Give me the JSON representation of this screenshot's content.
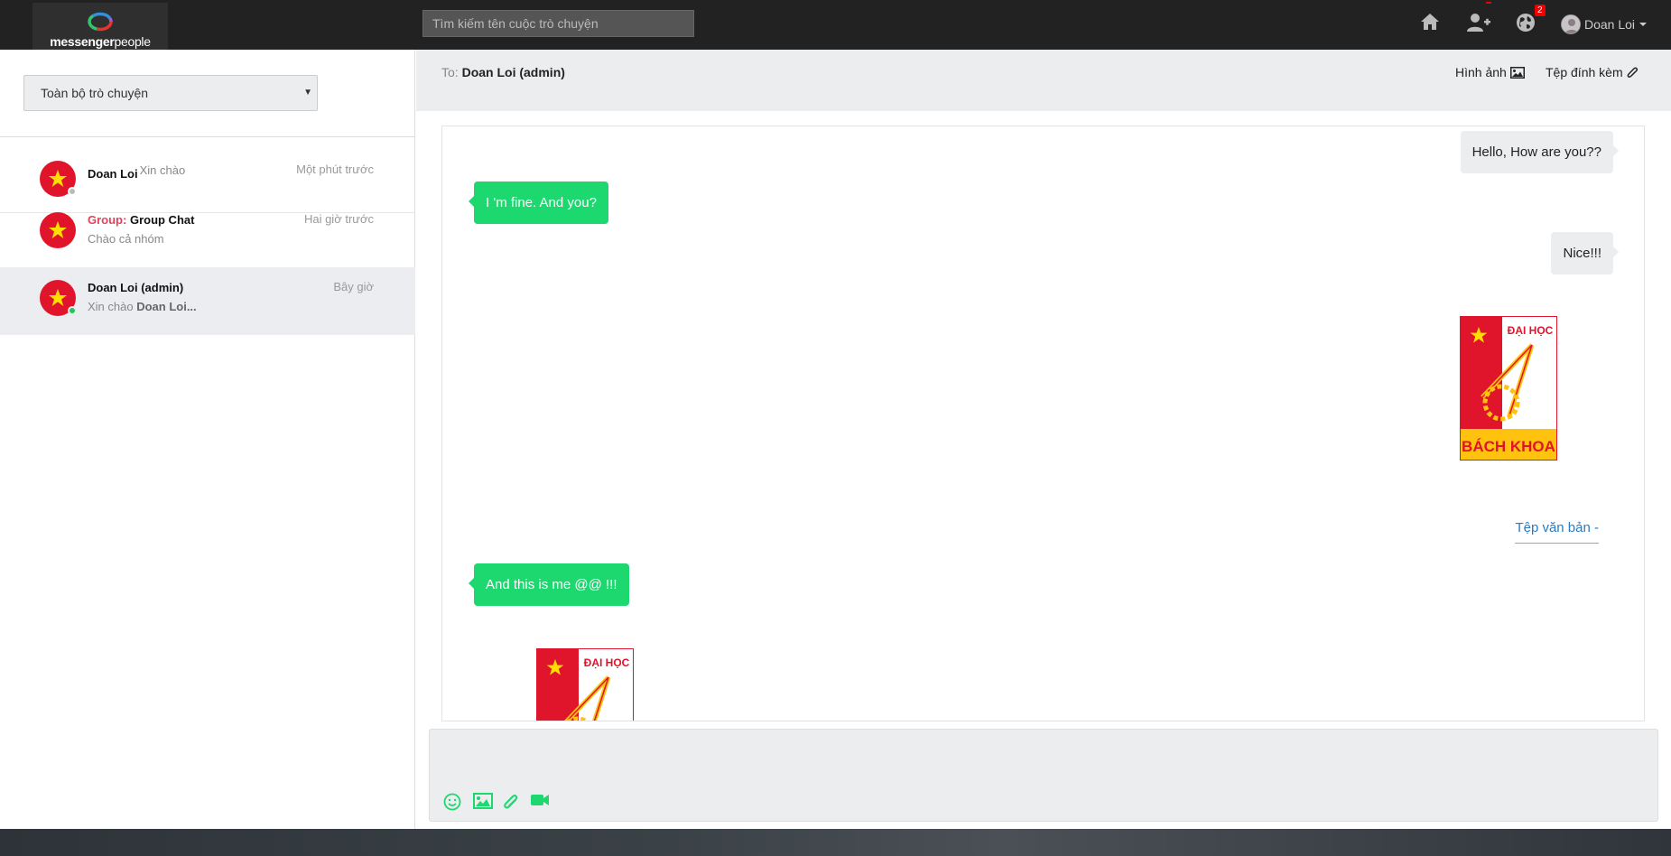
{
  "navbar": {
    "brand_bold": "messenger",
    "brand_light": "people",
    "search_placeholder": "Tìm kiếm tên cuộc trò chuyện",
    "icons": [
      "home-icon",
      "add-user-icon",
      "globe-icon"
    ],
    "notification_count": "2",
    "user_name": "Doan Loi"
  },
  "sidebar": {
    "filter_value": "Toàn bộ trò chuyện",
    "conversations": [
      {
        "name": "Doan Loi",
        "preview": "Xin chào",
        "time": "Một phút trước",
        "status": "offline",
        "status_color": "#bbbbbb"
      },
      {
        "group_prefix": "Group:",
        "name": "Group Chat",
        "preview": "Chào cả nhóm",
        "time": "Hai giờ trước"
      },
      {
        "name": "Doan Loi (admin)",
        "preview_prefix": "Xin chào",
        "preview_bold": "Doan Loi...",
        "time": "Bây giờ",
        "status": "online",
        "status_color": "#22c55e",
        "active": true
      }
    ]
  },
  "chat": {
    "to_label": "To:",
    "to_name": "Doan Loi (admin)",
    "actions": {
      "images": "Hình ảnh",
      "attachments": "Tệp đính kèm"
    },
    "messages": [
      {
        "from": "me",
        "text": "Hello, How are you??"
      },
      {
        "from": "them",
        "text": "I 'm fine. And you?"
      },
      {
        "from": "me",
        "text": "Nice!!!"
      },
      {
        "from": "me",
        "type": "image",
        "logo_top": "ĐẠI HỌC",
        "logo_bottom": "BÁCH KHOA"
      },
      {
        "from": "me",
        "type": "file",
        "text": "Tệp văn bản -"
      },
      {
        "from": "them",
        "text": "And this is me @@ !!!"
      },
      {
        "from": "them",
        "type": "image",
        "logo_top": "ĐẠI HỌC"
      }
    ]
  },
  "composer": {
    "placeholder": "",
    "tools": [
      "emoji-icon",
      "image-icon",
      "paperclip-icon",
      "video-icon"
    ]
  },
  "colors": {
    "accent_green": "#1dd76f",
    "navbar": "#222222",
    "group_label": "#e2435a",
    "link_blue": "#2a7bc4"
  }
}
